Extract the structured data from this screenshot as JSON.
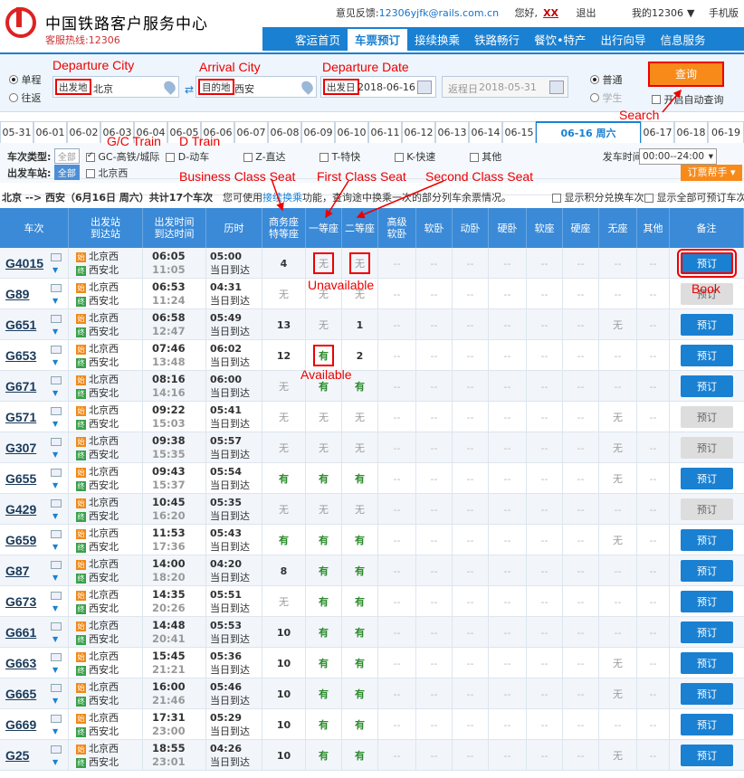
{
  "header": {
    "brand": "中国铁路客户服务中心",
    "hotline": "客服热线:12306",
    "feedback_label": "意见反馈:",
    "feedback_email": "12306yjfk@rails.com.cn",
    "greeting": "您好,",
    "user": "XX",
    "logout": "退出",
    "my12306": "我的12306",
    "mobile": "手机版"
  },
  "nav": [
    "客运首页",
    "车票预订",
    "接续换乘",
    "铁路畅行",
    "餐饮•特产",
    "出行向导",
    "信息服务"
  ],
  "query": {
    "oneway": "单程",
    "roundtrip": "往返",
    "from_tag": "出发地",
    "from_val": "北京",
    "to_tag": "目的地",
    "to_val": "西安",
    "date_tag": "出发日",
    "date_val": "2018-06-16",
    "return_label": "返程日",
    "return_val": "2018-05-31",
    "normal": "普通",
    "student": "学生",
    "search": "查询",
    "auto": "开启自动查询"
  },
  "annotations": {
    "departure_city": "Departure City",
    "arrival_city": "Arrival City",
    "departure_date": "Departure Date",
    "search": "Search",
    "gc_train": "G/C Train",
    "d_train": "D Train",
    "business": "Business Class Seat",
    "first": "First Class Seat",
    "second": "Second Class Seat",
    "unavailable": "Unavailable",
    "available": "Available",
    "book": "Book"
  },
  "dates": [
    "05-31",
    "06-01",
    "06-02",
    "06-03",
    "06-04",
    "06-05",
    "06-06",
    "06-07",
    "06-08",
    "06-09",
    "06-10",
    "06-11",
    "06-12",
    "06-13",
    "06-14",
    "06-15",
    "06-16 周六",
    "06-17",
    "06-18",
    "06-19"
  ],
  "filters": {
    "type_label": "车次类型:",
    "all": "全部",
    "gc": "GC-高铁/城际",
    "d": "D-动车",
    "z": "Z-直达",
    "t": "T-特快",
    "k": "K-快速",
    "other": "其他",
    "station_label": "出发车站:",
    "station_all": "全部",
    "station": "北京西",
    "time_label": "发车时间:",
    "time_val": "00:00--24:00",
    "helper": "订票帮手"
  },
  "summary": {
    "route": "北京 --> 西安（6月16日 周六）共计17个车次",
    "tip_pre": "您可使用",
    "tip_link": "接续换乘",
    "tip_post": "功能，查询途中换乘一次的部分列车余票情况。",
    "opt1": "显示积分兑换车次",
    "opt2": "显示全部可预订车次"
  },
  "columns": [
    "车次",
    "出发站\n到达站",
    "出发时间\n到达时间",
    "历时",
    "商务座\n特等座",
    "一等座",
    "二等座",
    "高级\n软卧",
    "软卧",
    "动卧",
    "硬卧",
    "软座",
    "硬座",
    "无座",
    "其他",
    "备注"
  ],
  "rows": [
    {
      "train": "G4015",
      "dep": "06:05",
      "arr": "11:05",
      "dur": "05:00",
      "biz": "4",
      "first": "无",
      "second": "无",
      "none": "--",
      "book": "预订",
      "bookable": true
    },
    {
      "train": "G89",
      "dep": "06:53",
      "arr": "11:24",
      "dur": "04:31",
      "biz": "无",
      "first": "无",
      "second": "无",
      "none": "--",
      "book": "预订",
      "bookable": false
    },
    {
      "train": "G651",
      "dep": "06:58",
      "arr": "12:47",
      "dur": "05:49",
      "biz": "13",
      "first": "无",
      "second": "1",
      "none": "无",
      "book": "预订",
      "bookable": true
    },
    {
      "train": "G653",
      "dep": "07:46",
      "arr": "13:48",
      "dur": "06:02",
      "biz": "12",
      "first": "有",
      "second": "2",
      "none": "--",
      "book": "预订",
      "bookable": true
    },
    {
      "train": "G671",
      "dep": "08:16",
      "arr": "14:16",
      "dur": "06:00",
      "biz": "无",
      "first": "有",
      "second": "有",
      "none": "--",
      "book": "预订",
      "bookable": true
    },
    {
      "train": "G571",
      "dep": "09:22",
      "arr": "15:03",
      "dur": "05:41",
      "biz": "无",
      "first": "无",
      "second": "无",
      "none": "无",
      "book": "预订",
      "bookable": false
    },
    {
      "train": "G307",
      "dep": "09:38",
      "arr": "15:35",
      "dur": "05:57",
      "biz": "无",
      "first": "无",
      "second": "无",
      "none": "无",
      "book": "预订",
      "bookable": false
    },
    {
      "train": "G655",
      "dep": "09:43",
      "arr": "15:37",
      "dur": "05:54",
      "biz": "有",
      "first": "有",
      "second": "有",
      "none": "无",
      "book": "预订",
      "bookable": true
    },
    {
      "train": "G429",
      "dep": "10:45",
      "arr": "16:20",
      "dur": "05:35",
      "biz": "无",
      "first": "无",
      "second": "无",
      "none": "--",
      "book": "预订",
      "bookable": false
    },
    {
      "train": "G659",
      "dep": "11:53",
      "arr": "17:36",
      "dur": "05:43",
      "biz": "有",
      "first": "有",
      "second": "有",
      "none": "无",
      "book": "预订",
      "bookable": true
    },
    {
      "train": "G87",
      "dep": "14:00",
      "arr": "18:20",
      "dur": "04:20",
      "biz": "8",
      "first": "有",
      "second": "有",
      "none": "--",
      "book": "预订",
      "bookable": true
    },
    {
      "train": "G673",
      "dep": "14:35",
      "arr": "20:26",
      "dur": "05:51",
      "biz": "无",
      "first": "有",
      "second": "有",
      "none": "--",
      "book": "预订",
      "bookable": true
    },
    {
      "train": "G661",
      "dep": "14:48",
      "arr": "20:41",
      "dur": "05:53",
      "biz": "10",
      "first": "有",
      "second": "有",
      "none": "--",
      "book": "预订",
      "bookable": true
    },
    {
      "train": "G663",
      "dep": "15:45",
      "arr": "21:21",
      "dur": "05:36",
      "biz": "10",
      "first": "有",
      "second": "有",
      "none": "无",
      "book": "预订",
      "bookable": true
    },
    {
      "train": "G665",
      "dep": "16:00",
      "arr": "21:46",
      "dur": "05:46",
      "biz": "10",
      "first": "有",
      "second": "有",
      "none": "无",
      "book": "预订",
      "bookable": true
    },
    {
      "train": "G669",
      "dep": "17:31",
      "arr": "23:00",
      "dur": "05:29",
      "biz": "10",
      "first": "有",
      "second": "有",
      "none": "--",
      "book": "预订",
      "bookable": true
    },
    {
      "train": "G25",
      "dep": "18:55",
      "arr": "23:01",
      "dur": "04:26",
      "biz": "10",
      "first": "有",
      "second": "有",
      "none": "无",
      "book": "预订",
      "bookable": true
    }
  ],
  "station": {
    "from": "北京西",
    "to": "西安北",
    "from_icon": "始",
    "to_icon": "终",
    "same_day": "当日到达"
  },
  "colors": {
    "brand": "#1a80d2",
    "accent": "#f88a1a",
    "annotation": "#e00000"
  }
}
